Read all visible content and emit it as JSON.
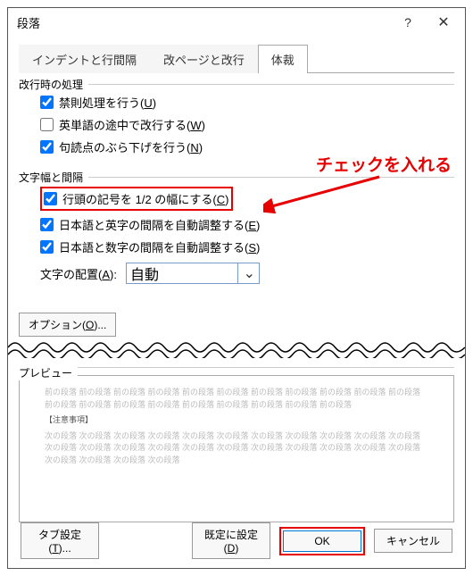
{
  "title": "段落",
  "tabs": {
    "t1": "インデントと行間隔",
    "t2": "改ページと改行",
    "t3": "体裁"
  },
  "group1": {
    "label": "改行時の処理",
    "c1": "禁則処理を行う(U)",
    "c2": "英単語の途中で改行する(W)",
    "c3": "句読点のぶら下げを行う(N)"
  },
  "group2": {
    "label": "文字幅と間隔",
    "c1": "行頭の記号を 1/2 の幅にする(C)",
    "c2": "日本語と英字の間隔を自動調整する(E)",
    "c3": "日本語と数字の間隔を自動調整する(S)",
    "align_label": "文字の配置(A):",
    "align_value": "自動"
  },
  "option_btn": "オプション(O)...",
  "preview_label": "プレビュー",
  "preview_text_light": "前の段落 前の段落 前の段落 前の段落 前の段落 前の段落 前の段落 前の段落 前の段落 前の段落 前の段落 前の段落 前の段落 前の段落 前の段落 前の段落 前の段落 前の段落 前の段落 前の段落",
  "preview_text_dark": "【注意事項】",
  "preview_text_light2": "次の段落 次の段落 次の段落 次の段落 次の段落 次の段落 次の段落 次の段落 次の段落 次の段落 次の段落 次の段落 次の段落 次の段落 次の段落 次の段落 次の段落 次の段落 次の段落 次の段落 次の段落 次の段落 次の段落 次の段落 次の段落 次の段落",
  "footer": {
    "tab_settings": "タブ設定(T)...",
    "default": "既定に設定(D)",
    "ok": "OK",
    "cancel": "キャンセル"
  },
  "annotation": "チェックを入れる"
}
